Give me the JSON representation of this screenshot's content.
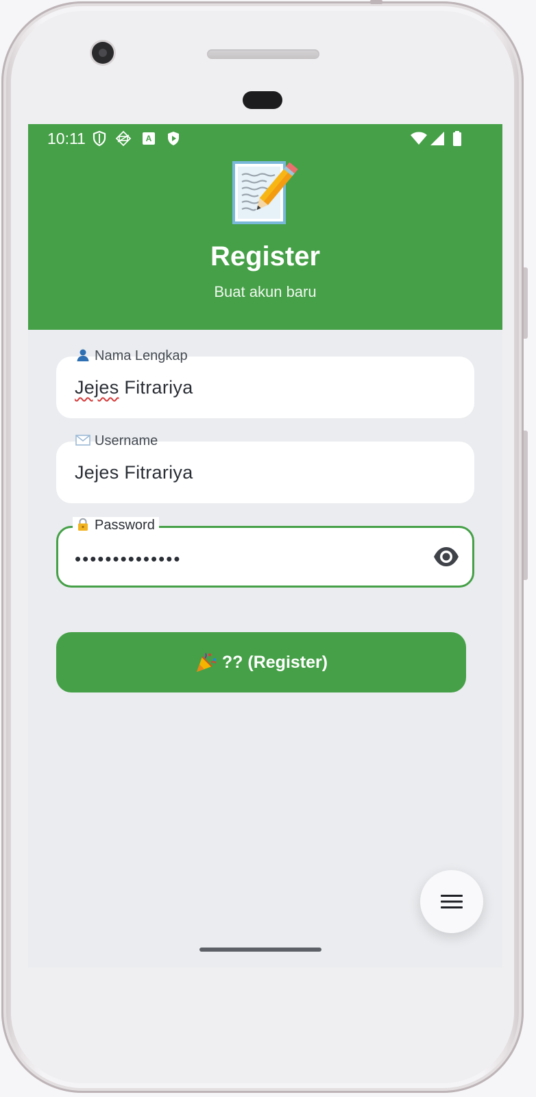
{
  "status_bar": {
    "time": "10:11",
    "left_icons": [
      "shield-outline-icon",
      "vpn-key-icon",
      "a-text-icon",
      "play-shield-icon"
    ],
    "right_icons": [
      "wifi-icon",
      "signal-icon",
      "battery-icon"
    ]
  },
  "header": {
    "emoji": "memo-pencil-icon",
    "title": "Register",
    "subtitle": "Buat akun baru",
    "background_color": "#45a047"
  },
  "form": {
    "full_name": {
      "label": "Nama Lengkap",
      "icon": "person-icon",
      "value": "Jejes Fitrariya"
    },
    "username": {
      "label": "Username",
      "icon": "envelope-icon",
      "value": "Jejes Fitrariya"
    },
    "password": {
      "label": "Password",
      "icon": "lock-icon",
      "value": "••••••••••••••",
      "toggle_icon": "eye-icon",
      "focused": true,
      "focus_color": "#45a047"
    },
    "register_button": {
      "icon": "party-popper-icon",
      "label": "?? (Register)"
    }
  },
  "fab": {
    "icon": "hamburger-menu-icon"
  }
}
